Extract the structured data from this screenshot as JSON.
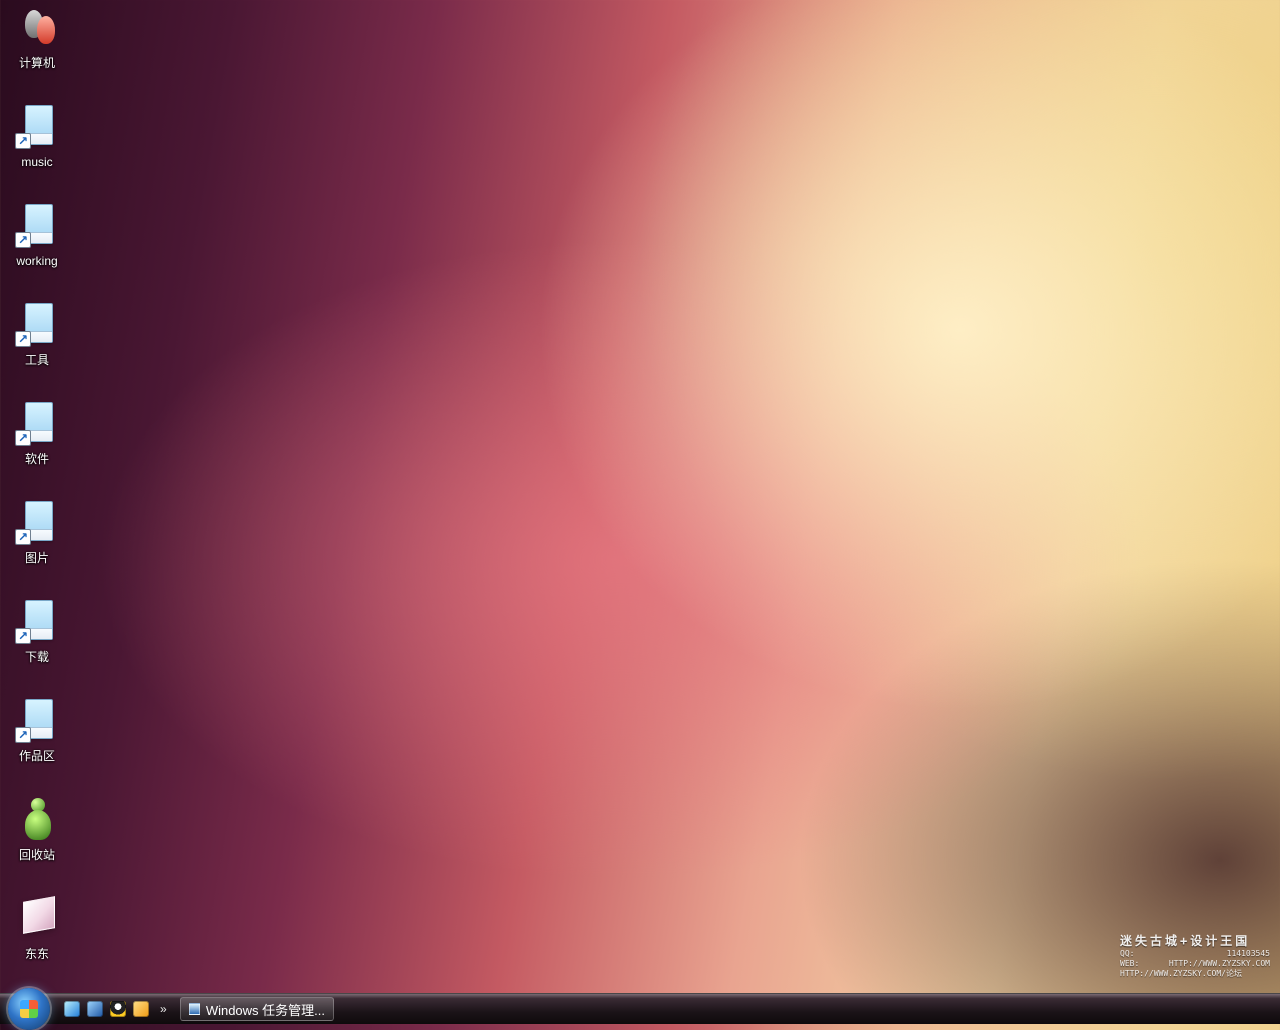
{
  "desktop": {
    "icons": [
      {
        "label": "计算机",
        "icon": "computer-people-icon"
      },
      {
        "label": "music",
        "icon": "shortcut-doc-icon"
      },
      {
        "label": "working",
        "icon": "shortcut-doc-icon"
      },
      {
        "label": "工具",
        "icon": "shortcut-doc-icon"
      },
      {
        "label": "软件",
        "icon": "shortcut-doc-icon"
      },
      {
        "label": "图片",
        "icon": "shortcut-doc-icon"
      },
      {
        "label": "下载",
        "icon": "shortcut-doc-icon"
      },
      {
        "label": "作品区",
        "icon": "shortcut-doc-icon"
      },
      {
        "label": "回收站",
        "icon": "recycle-bin-icon"
      },
      {
        "label": "东东",
        "icon": "box-icon"
      }
    ],
    "shortcut_arrow": "↗"
  },
  "taskbar": {
    "quicklaunch": [
      {
        "icon": "internet-explorer-icon"
      },
      {
        "icon": "show-desktop-icon"
      },
      {
        "icon": "qq-icon"
      },
      {
        "icon": "media-player-icon"
      }
    ],
    "chevron": "»",
    "task_button": {
      "label": "Windows 任务管理...",
      "icon": "task-manager-icon"
    }
  },
  "watermark": {
    "title": "迷失古城+设计王国",
    "qq_label": "QQ:",
    "qq_value": "114103545",
    "web_label": "WEB:",
    "web_value": "HTTP://WWW.ZYZSKY.COM",
    "web2": "HTTP://WWW.ZYZSKY.COM/论坛"
  }
}
